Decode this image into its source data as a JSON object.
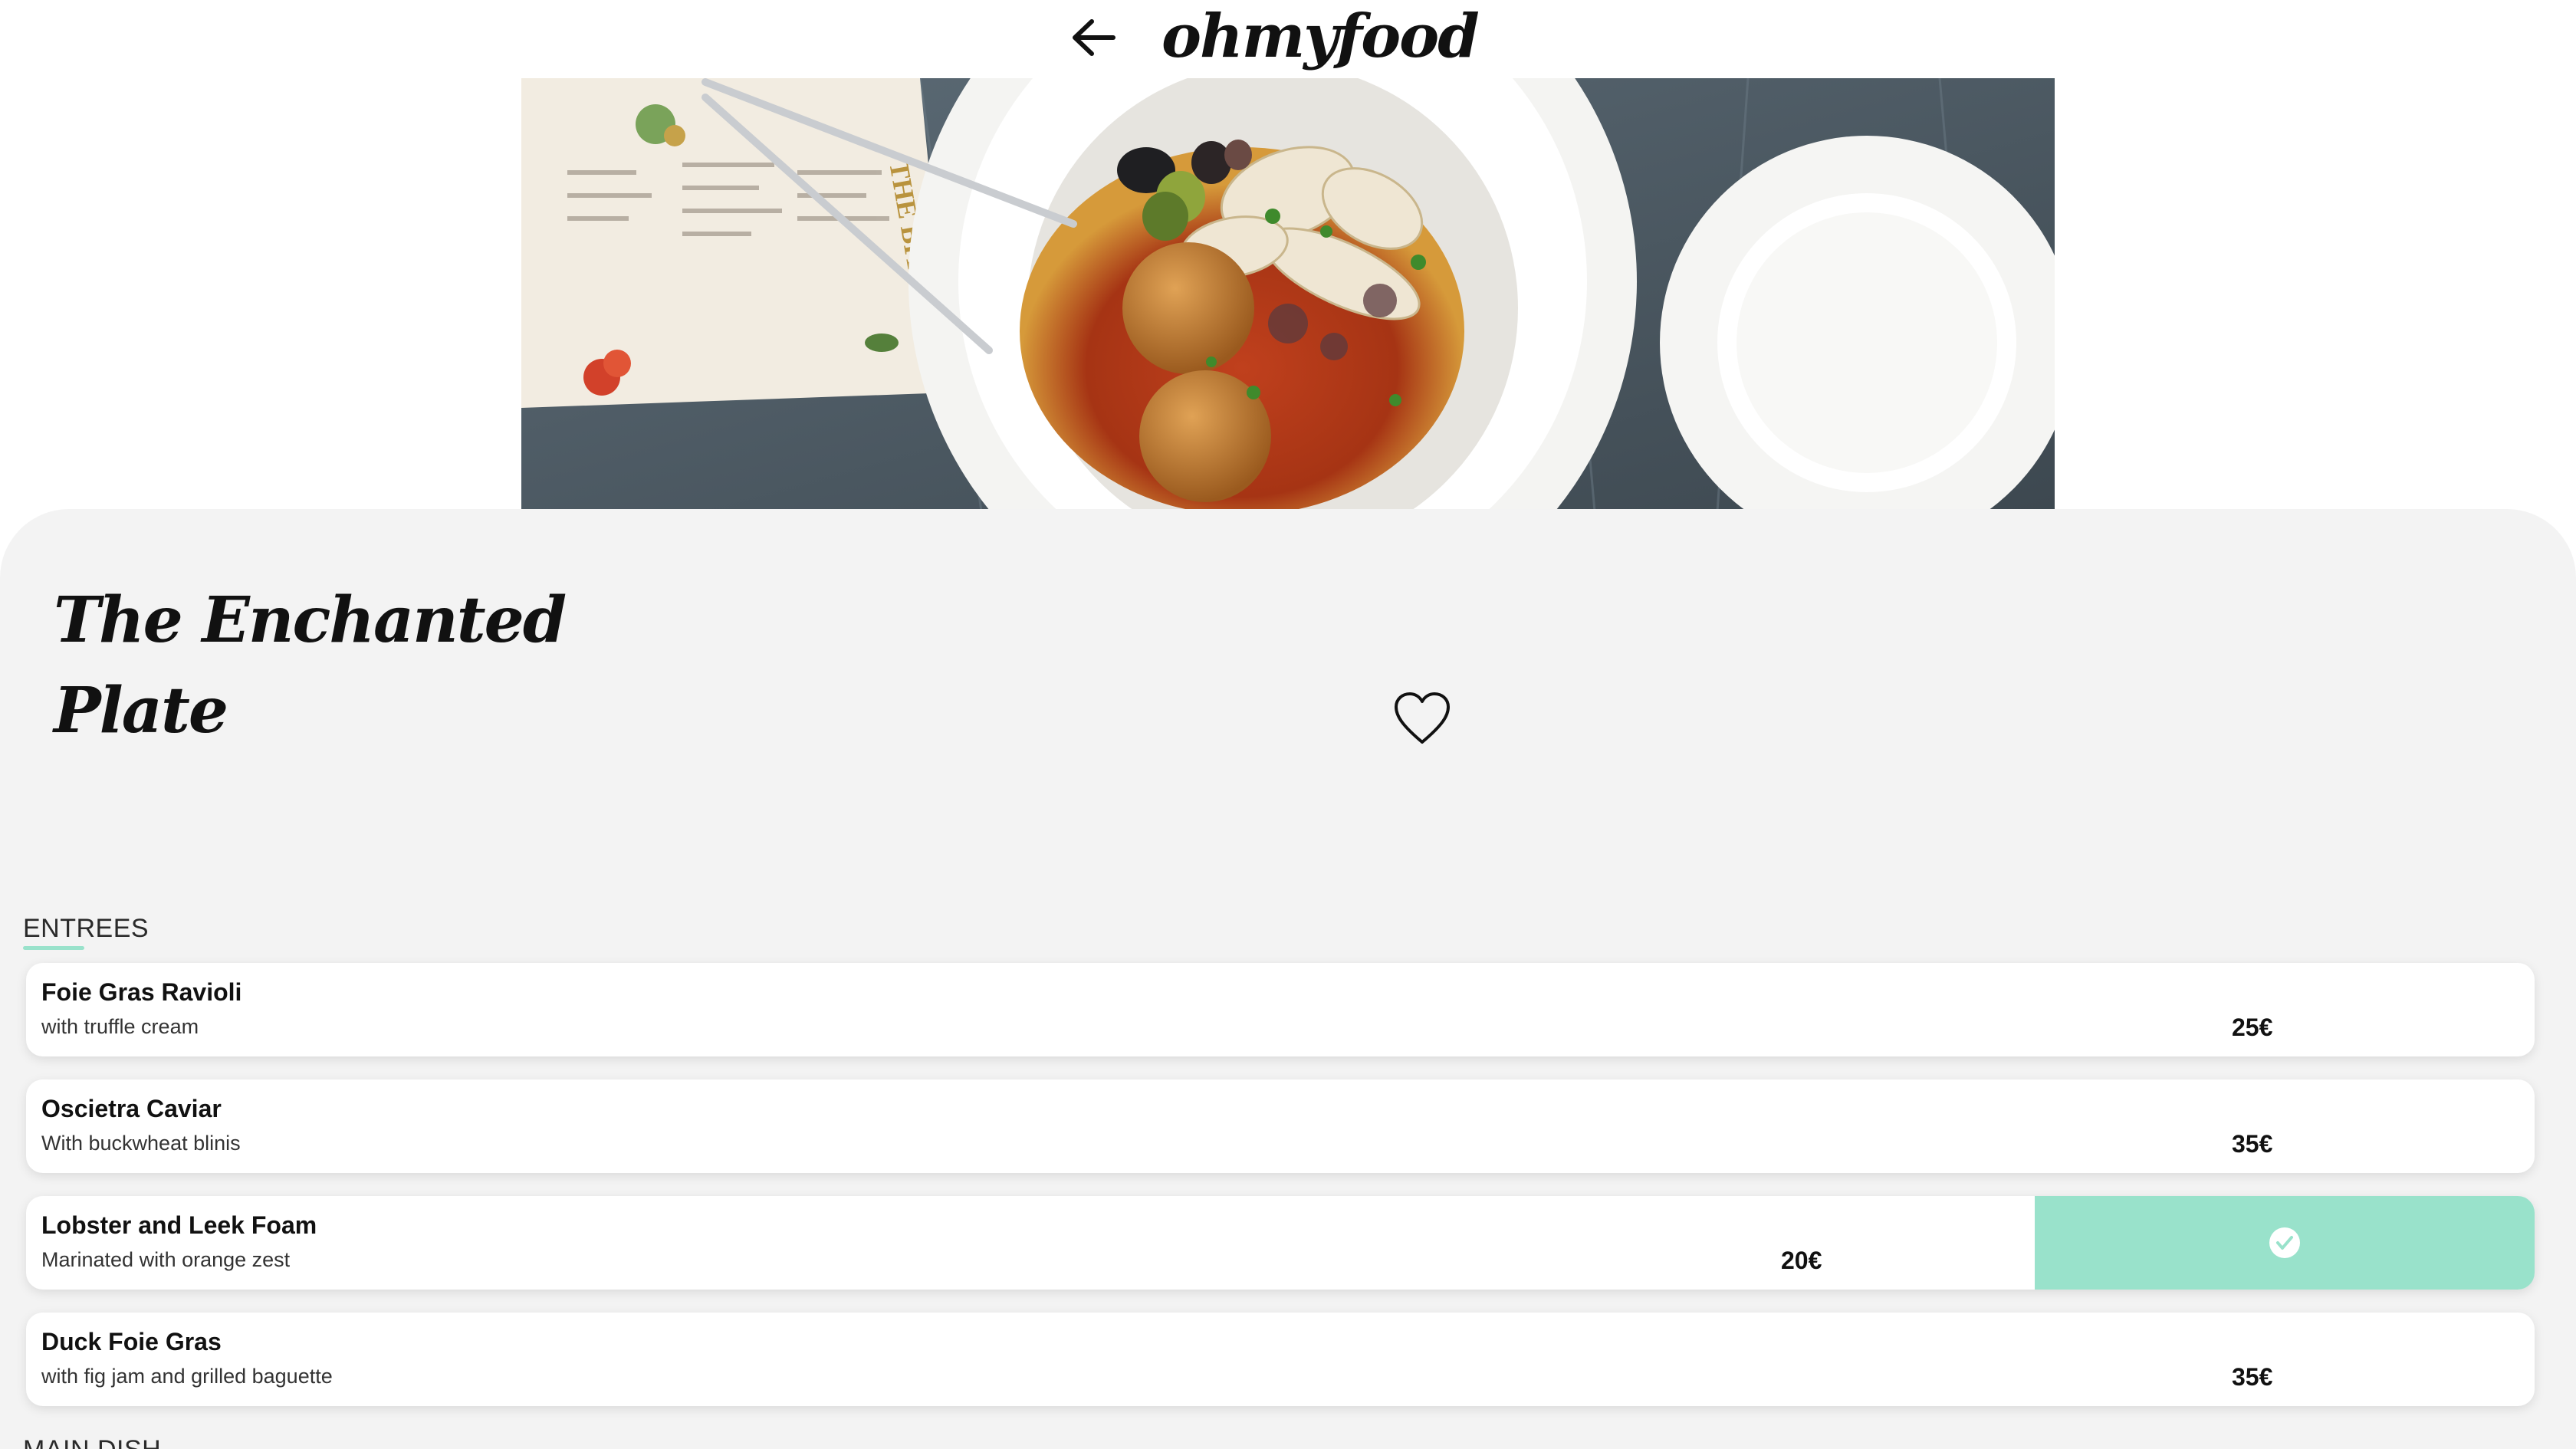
{
  "header": {
    "brand": "ohmyfood",
    "back_icon": "arrow-left-icon"
  },
  "hero": {
    "image": "hero-food-photo",
    "menu_card_text": "THE BITE"
  },
  "restaurant": {
    "name": "The Enchanted Plate",
    "favorite_icon": "heart-outline-icon"
  },
  "sections": [
    {
      "label": "ENTREES",
      "items": [
        {
          "name": "Foie Gras Ravioli",
          "description": "with truffle cream",
          "price": "25€",
          "selected": false
        },
        {
          "name": "Oscietra Caviar",
          "description": "With buckwheat blinis",
          "price": "35€",
          "selected": false
        },
        {
          "name": "Lobster and Leek Foam",
          "description": "Marinated with orange zest",
          "price": "20€",
          "selected": true
        },
        {
          "name": "Duck Foie Gras",
          "description": "with fig jam and grilled baguette",
          "price": "35€",
          "selected": false
        }
      ]
    },
    {
      "label": "MAIN DISH",
      "items": []
    }
  ],
  "colors": {
    "accent": "#99e2cb",
    "sheet_background": "#f3f3f3",
    "text": "#111111"
  }
}
